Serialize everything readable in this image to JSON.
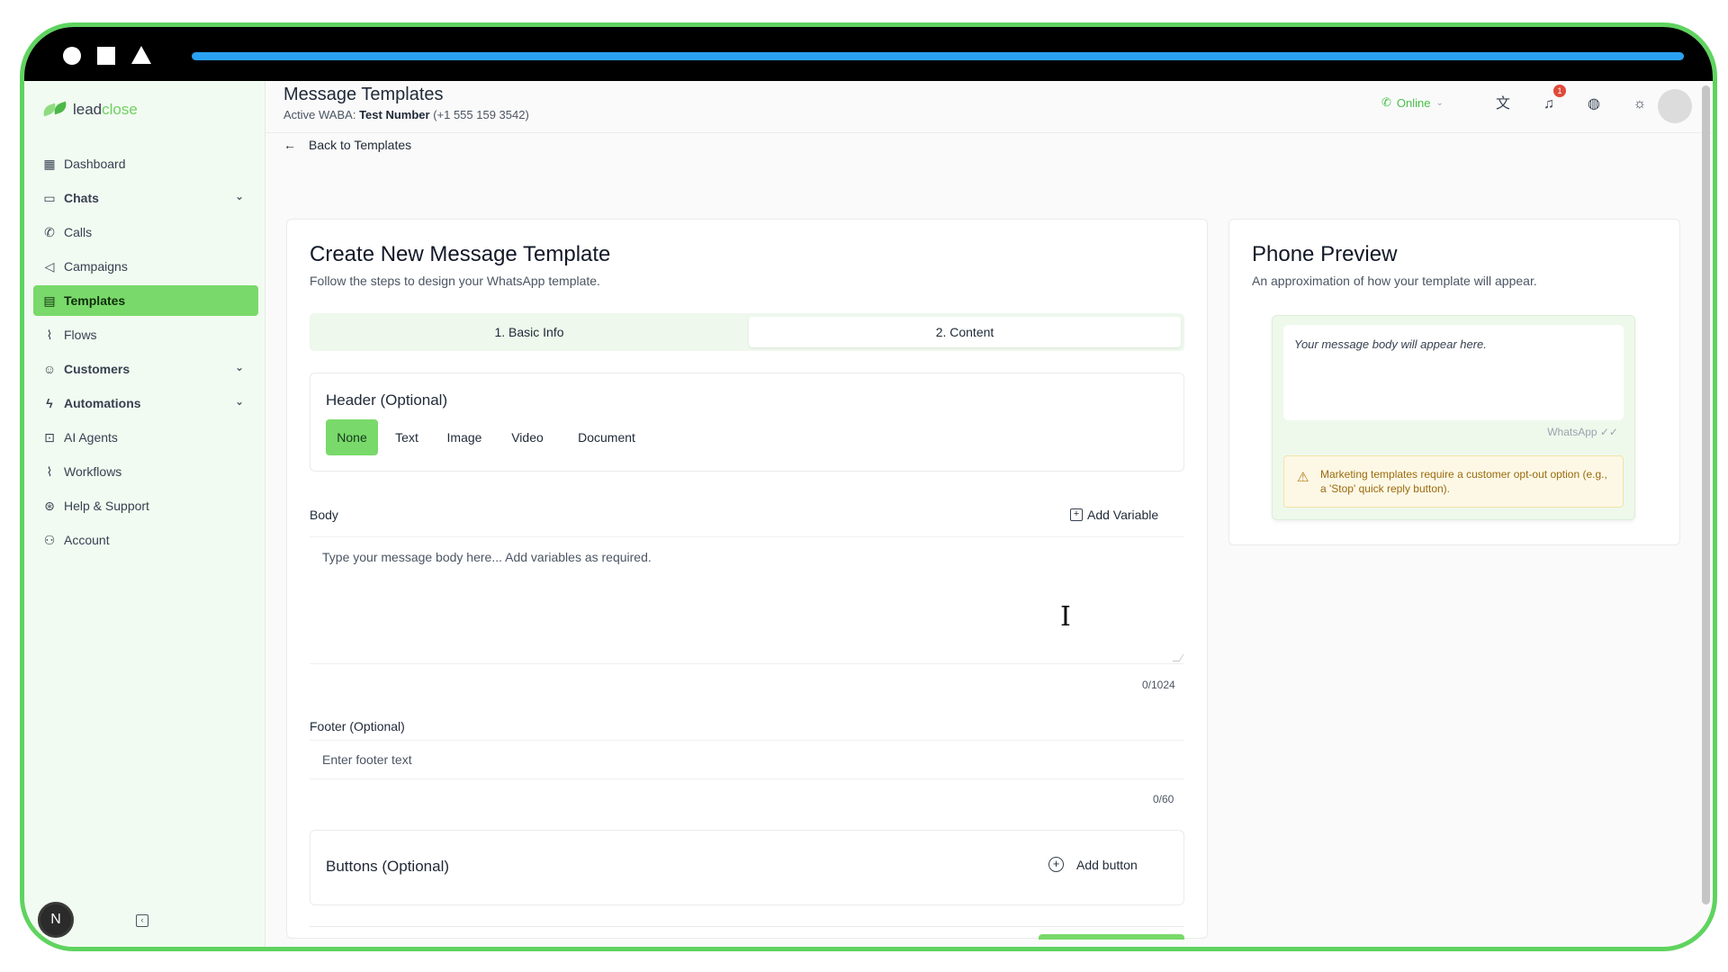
{
  "sidebar": {
    "logo_lead": "lead",
    "logo_close": "close",
    "items": [
      {
        "label": "Dashboard",
        "icon": "grid-icon"
      },
      {
        "label": "Chats",
        "icon": "chat-icon",
        "expandable": true
      },
      {
        "label": "Calls",
        "icon": "phone-icon"
      },
      {
        "label": "Campaigns",
        "icon": "megaphone-icon"
      },
      {
        "label": "Templates",
        "icon": "file-icon",
        "active": true
      },
      {
        "label": "Flows",
        "icon": "flow-icon"
      },
      {
        "label": "Customers",
        "icon": "users-icon",
        "expandable": true
      },
      {
        "label": "Automations",
        "icon": "bolt-icon",
        "expandable": true
      },
      {
        "label": "AI Agents",
        "icon": "bot-icon"
      },
      {
        "label": "Workflows",
        "icon": "workflow-icon"
      },
      {
        "label": "Help & Support",
        "icon": "lifebuoy-icon"
      },
      {
        "label": "Account",
        "icon": "user-cog-icon"
      }
    ],
    "user_initial": "N"
  },
  "header": {
    "title": "Message Templates",
    "waba_prefix": "Active WABA:",
    "waba_name": "Test Number",
    "waba_number": "(+1 555 159 3542)",
    "status": "Online",
    "notification_count": "1"
  },
  "back_link": "Back to Templates",
  "form": {
    "title": "Create New Message Template",
    "subtitle": "Follow the steps to design your WhatsApp template.",
    "steps": [
      "1. Basic Info",
      "2. Content"
    ],
    "active_step": 2,
    "header_section": {
      "title": "Header (Optional)",
      "types": [
        "None",
        "Text",
        "Image",
        "Video",
        "Document"
      ],
      "selected": "None"
    },
    "body": {
      "label": "Body",
      "add_variable": "Add Variable",
      "placeholder": "Type your message body here... Add variables as required.",
      "counter": "0/1024"
    },
    "footer": {
      "label": "Footer (Optional)",
      "placeholder": "Enter footer text",
      "counter": "0/60"
    },
    "buttons": {
      "title": "Buttons (Optional)",
      "add_label": "Add button"
    }
  },
  "preview": {
    "title": "Phone Preview",
    "subtitle": "An approximation of how your template will appear.",
    "body_placeholder": "Your message body will appear here.",
    "meta": "WhatsApp ✓✓",
    "warning": "Marketing templates require a customer opt-out option (e.g., a 'Stop' quick reply button)."
  },
  "colors": {
    "accent": "#79d96a",
    "frame": "#5fd35f",
    "progress": "#2aa2f3",
    "badge": "#e04a3a"
  }
}
